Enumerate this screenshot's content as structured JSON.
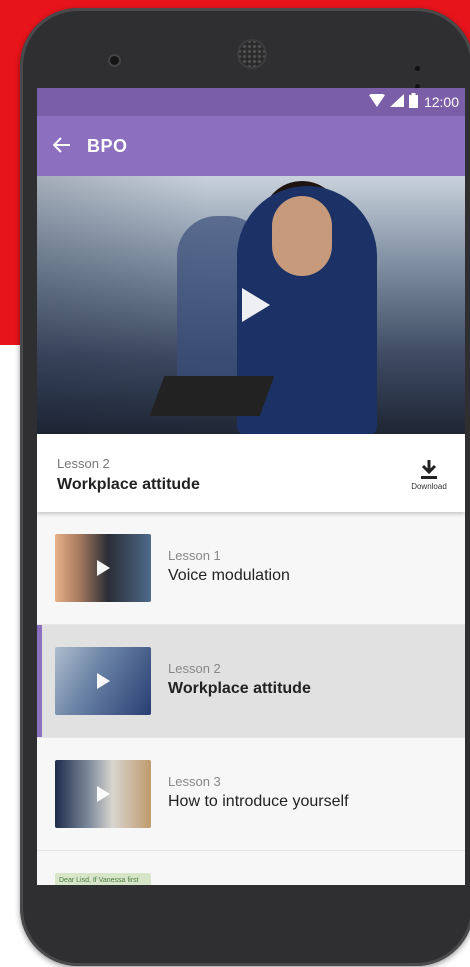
{
  "status_bar": {
    "time": "12:00",
    "icons": [
      "wifi-icon",
      "signal-icon",
      "battery-icon"
    ]
  },
  "app_bar": {
    "back_icon": "arrow-left-icon",
    "title": "BPO"
  },
  "hero_video": {
    "play_icon": "play-icon"
  },
  "current_lesson": {
    "number": "Lesson 2",
    "title": "Workplace attitude",
    "download_label": "Download",
    "download_icon": "download-icon"
  },
  "lessons": [
    {
      "number": "Lesson 1",
      "title": "Voice modulation",
      "active": false
    },
    {
      "number": "Lesson 2",
      "title": "Workplace attitude",
      "active": true
    },
    {
      "number": "Lesson 3",
      "title": "How to introduce yourself",
      "active": false
    }
  ],
  "partial_item_thumb_text": "Dear Lisd, If Vanessa first",
  "colors": {
    "brand_purple": "#8c6fbe",
    "status_purple": "#7a5ea7",
    "background_red": "#e8141b"
  }
}
